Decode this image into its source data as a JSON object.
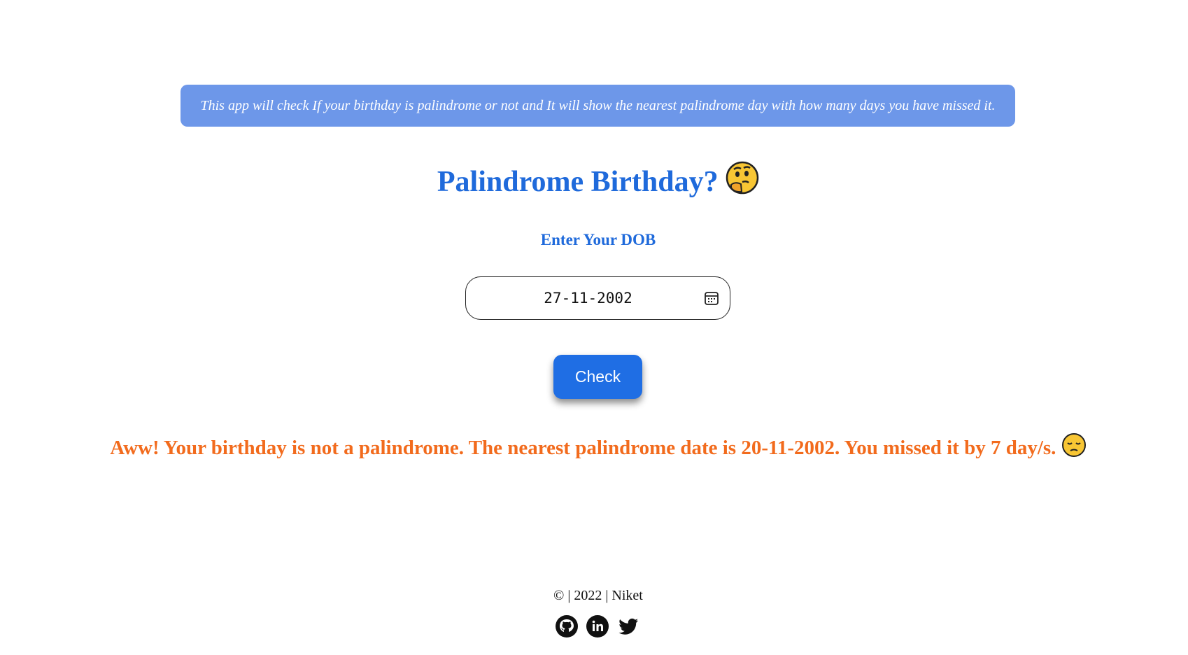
{
  "banner": {
    "text": "This app will check If your birthday is palindrome or not and It will show the nearest palindrome day with how many days you have missed it."
  },
  "header": {
    "title": "Palindrome Birthday?",
    "emoji_icon": "thinking-face-emoji"
  },
  "form": {
    "dob_label": "Enter Your DOB",
    "dob_value": "27-11-2002",
    "calendar_icon": "calendar-icon",
    "check_label": "Check"
  },
  "result": {
    "message": "Aww! Your birthday is not a palindrome. The nearest palindrome date is 20-11-2002. You missed it by 7 day/s.",
    "emoji_icon": "pensive-face-emoji"
  },
  "footer": {
    "text": "© | 2022 | Niket",
    "socials": [
      "github-icon",
      "linkedin-icon",
      "twitter-icon"
    ]
  },
  "colors": {
    "banner_bg": "#6d97e9",
    "primary_blue": "#1f6adb",
    "button_blue": "#1f6ee4",
    "result_orange": "#f26b1d"
  }
}
